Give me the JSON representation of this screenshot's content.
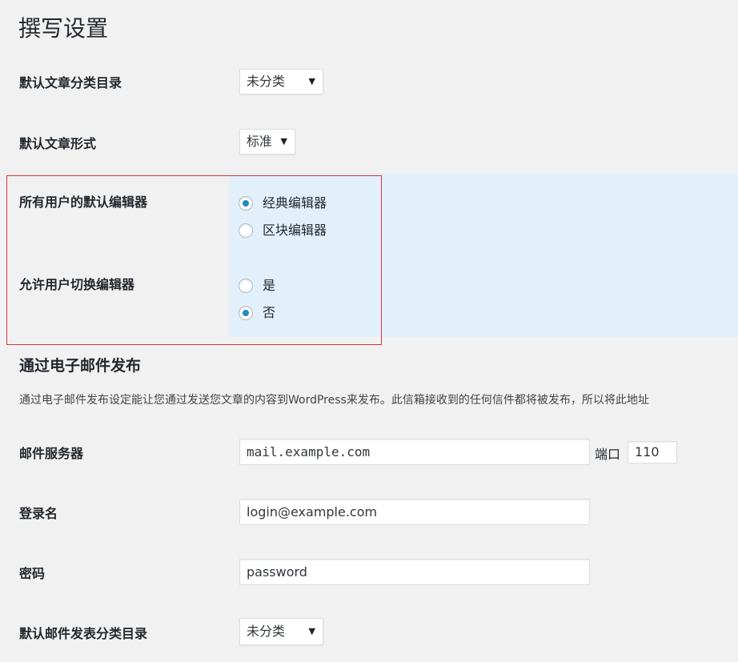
{
  "page_title": "撰写设置",
  "default_category": {
    "label": "默认文章分类目录",
    "selected": "未分类"
  },
  "default_format": {
    "label": "默认文章形式",
    "selected": "标准"
  },
  "default_editor": {
    "label": "所有用户的默认编辑器",
    "options": [
      {
        "label": "经典编辑器",
        "checked": true
      },
      {
        "label": "区块编辑器",
        "checked": false
      }
    ]
  },
  "allow_switch": {
    "label": "允许用户切换编辑器",
    "options": [
      {
        "label": "是",
        "checked": false
      },
      {
        "label": "否",
        "checked": true
      }
    ]
  },
  "post_via_email": {
    "heading": "通过电子邮件发布",
    "description": "通过电子邮件发布设定能让您通过发送您文章的内容到WordPress来发布。此信箱接收到的任何信件都将被发布，所以将此地址"
  },
  "mail_server": {
    "label": "邮件服务器",
    "value": "mail.example.com",
    "port_label": "端口",
    "port_value": "110"
  },
  "login_name": {
    "label": "登录名",
    "value": "login@example.com"
  },
  "password": {
    "label": "密码",
    "value": "password"
  },
  "mail_category": {
    "label": "默认邮件发表分类目录",
    "selected": "未分类"
  },
  "colors": {
    "highlight_bg": "#e2f0fb",
    "highlight_border": "#d63638",
    "radio_dot": "#1e8cbe"
  }
}
